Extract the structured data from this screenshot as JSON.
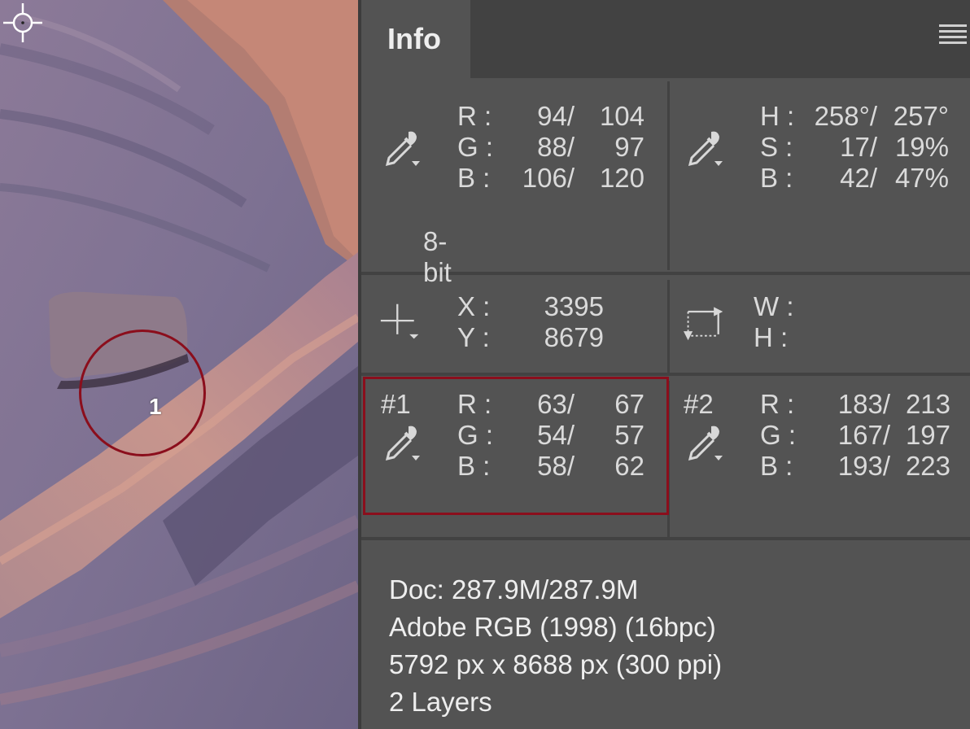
{
  "panel": {
    "tab_label": "Info",
    "menu_icon": "panel-menu-icon"
  },
  "rgb_readout": {
    "rows": [
      {
        "label": "R :",
        "before": "94/",
        "after": "104"
      },
      {
        "label": "G :",
        "before": "88/",
        "after": "97"
      },
      {
        "label": "B :",
        "before": "106/",
        "after": "120"
      }
    ],
    "bit_depth": "8-bit"
  },
  "hsb_readout": {
    "rows": [
      {
        "label": "H :",
        "before": "258°/",
        "after": "257°"
      },
      {
        "label": "S :",
        "before": "17/",
        "after": "19%"
      },
      {
        "label": "B :",
        "before": "42/",
        "after": "47%"
      }
    ]
  },
  "position": {
    "x_label": "X :",
    "x_value": "3395",
    "y_label": "Y :",
    "y_value": "8679"
  },
  "size": {
    "w_label": "W :",
    "w_value": "",
    "h_label": "H :",
    "h_value": ""
  },
  "sampler1": {
    "tag": "#1",
    "rows": [
      {
        "label": "R :",
        "before": "63/",
        "after": "67"
      },
      {
        "label": "G :",
        "before": "54/",
        "after": "57"
      },
      {
        "label": "B :",
        "before": "58/",
        "after": "62"
      }
    ]
  },
  "sampler2": {
    "tag": "#2",
    "rows": [
      {
        "label": "R :",
        "before": "183/",
        "after": "213"
      },
      {
        "label": "G :",
        "before": "167/",
        "after": "197"
      },
      {
        "label": "B :",
        "before": "193/",
        "after": "223"
      }
    ]
  },
  "doc_info": {
    "doc_size": "Doc: 287.9M/287.9M",
    "profile": "Adobe RGB (1998) (16bpc)",
    "dimensions": "5792 px x 8688 px (300 ppi)",
    "layers": "2 Layers"
  },
  "canvas": {
    "sampler_marker_label": "1",
    "highlight_color": "#8b0e1c"
  }
}
